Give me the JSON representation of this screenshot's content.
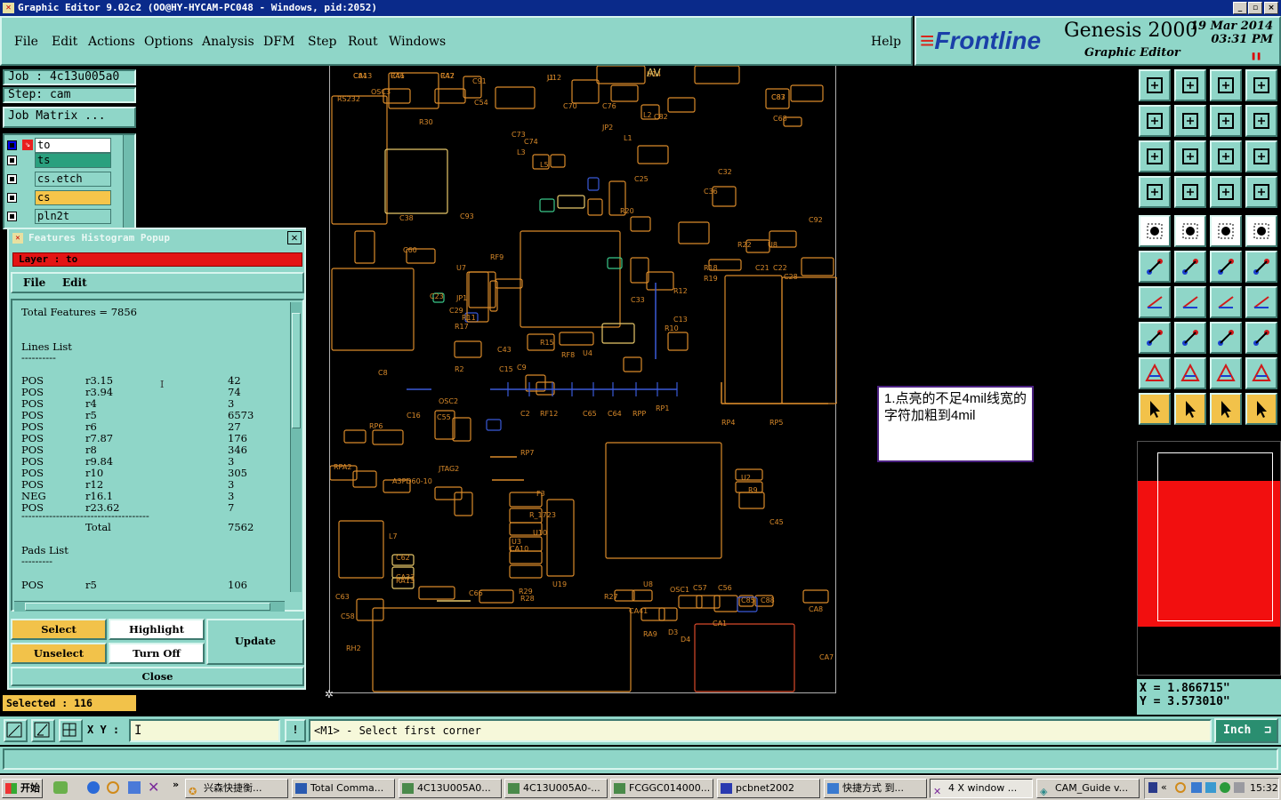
{
  "window": {
    "title": "Graphic Editor 9.02c2 (OO@HY-HYCAM-PC048 - Windows, pid:2052)",
    "controls": [
      "_",
      "▫",
      "×"
    ]
  },
  "menu": [
    "File",
    "Edit",
    "Actions",
    "Options",
    "Analysis",
    "DFM",
    "Step",
    "Rout",
    "Windows"
  ],
  "help_label": "Help",
  "brand": {
    "logo": "Frontline",
    "product": "Genesis 2000",
    "subtitle": "Graphic Editor",
    "date": "19 Mar 2014",
    "time": "03:31 PM",
    "accent": "#d9261c"
  },
  "job": {
    "job_label": "Job : 4c13u005a0",
    "step_label": "Step: cam",
    "matrix_button": "Job Matrix ..."
  },
  "layers": [
    {
      "name": "to",
      "color": "#ffffff"
    },
    {
      "name": "ts",
      "color": "#2aa07e"
    },
    {
      "name": "cs.etch",
      "color": "#8fd6c8"
    },
    {
      "name": "cs",
      "color": "#f6c54a"
    },
    {
      "name": "pln2t",
      "color": "#8fd6c8"
    }
  ],
  "histogram": {
    "title": "Features Histogram Popup",
    "layer_label": "Layer :  to",
    "menu": [
      "File",
      "Edit"
    ],
    "total_features": "Total Features = 7856",
    "lines_heading": "Lines List",
    "lines_underline": "----------",
    "lines": [
      {
        "pol": "POS",
        "sym": "r3.15",
        "count": "42"
      },
      {
        "pol": "POS",
        "sym": "r3.94",
        "count": "74"
      },
      {
        "pol": "POS",
        "sym": "r4",
        "count": "3"
      },
      {
        "pol": "POS",
        "sym": "r5",
        "count": "6573"
      },
      {
        "pol": "POS",
        "sym": "r6",
        "count": "27"
      },
      {
        "pol": "POS",
        "sym": "r7.87",
        "count": "176"
      },
      {
        "pol": "POS",
        "sym": "r8",
        "count": "346"
      },
      {
        "pol": "POS",
        "sym": "r9.84",
        "count": "3"
      },
      {
        "pol": "POS",
        "sym": "r10",
        "count": "305"
      },
      {
        "pol": "POS",
        "sym": "r12",
        "count": "3"
      },
      {
        "pol": "NEG",
        "sym": "r16.1",
        "count": "3"
      },
      {
        "pol": "POS",
        "sym": "r23.62",
        "count": "7"
      }
    ],
    "separator": "-------------------------------------",
    "total_label": "Total",
    "total_value": "7562",
    "pads_heading": "Pads List",
    "pads_underline": "---------",
    "pads": [
      {
        "pol": "POS",
        "sym": "r5",
        "count": "106"
      }
    ],
    "buttons": {
      "select": "Select",
      "highlight": "Highlight",
      "update": "Update",
      "unselect": "Unselect",
      "turn_off": "Turn Off",
      "close": "Close"
    }
  },
  "selected_label": "Selected : 116",
  "note": "1.点亮的不足4mil线宽的字符加粗到4mil",
  "coords": {
    "x": "X =  1.866715\"",
    "y": "Y =  3.573010\""
  },
  "command": {
    "xy_label": "X Y :",
    "xy_value": "",
    "prompt": "<M1> - Select first corner",
    "units": "Inch"
  },
  "pcb_labels": [
    "C84",
    "C46",
    "C47",
    "U12",
    "U14",
    "C83",
    "RS232",
    "OSC3",
    "R30",
    "C91",
    "C54",
    "C70",
    "C76",
    "C82",
    "C68",
    "C74",
    "C73",
    "L1",
    "L2",
    "L3",
    "L5",
    "JP2",
    "C25",
    "R20",
    "C36",
    "C32",
    "C93",
    "C92",
    "C38",
    "C60",
    "R11",
    "U7",
    "R22",
    "U8",
    "R18",
    "C21",
    "C22",
    "C28",
    "C23",
    "C29",
    "JP1",
    "C33",
    "R12",
    "R19",
    "C13",
    "R17",
    "R10",
    "RF9",
    "C43",
    "R15",
    "RF8",
    "U4",
    "C8",
    "R2",
    "C15",
    "C9",
    "OSC2",
    "C55",
    "C16",
    "C2",
    "RF12",
    "C65",
    "C64",
    "RPP",
    "RP1",
    "RP4",
    "RP5",
    "RP6",
    "RP7",
    "RPA2",
    "JTAG2",
    "A3PD60-10",
    "F3",
    "U2",
    "R9",
    "C45",
    "R_1723",
    "L7",
    "U10",
    "C62",
    "U3",
    "CA33",
    "CA10",
    "RA13",
    "C66",
    "U19",
    "R29",
    "R28",
    "C63",
    "C58",
    "R27",
    "U8",
    "OSC1",
    "C57",
    "C56",
    "C85",
    "C88",
    "CA8",
    "CA41",
    "CA1",
    "RA9",
    "D3",
    "D4",
    "RH2",
    "CA7",
    "CA13",
    "RA1",
    "RA2",
    "J1",
    "AV",
    "C87"
  ],
  "taskbar": {
    "start": "开始",
    "tasks": [
      "兴森快捷衡...",
      "Total Comma...",
      "4C13U005A0...",
      "4C13U005A0-...",
      "FCGGC014000...",
      "pcbnet2002",
      "快捷方式 到...",
      "4 X window ...",
      "CAM_Guide v..."
    ],
    "clock": "15:32"
  }
}
